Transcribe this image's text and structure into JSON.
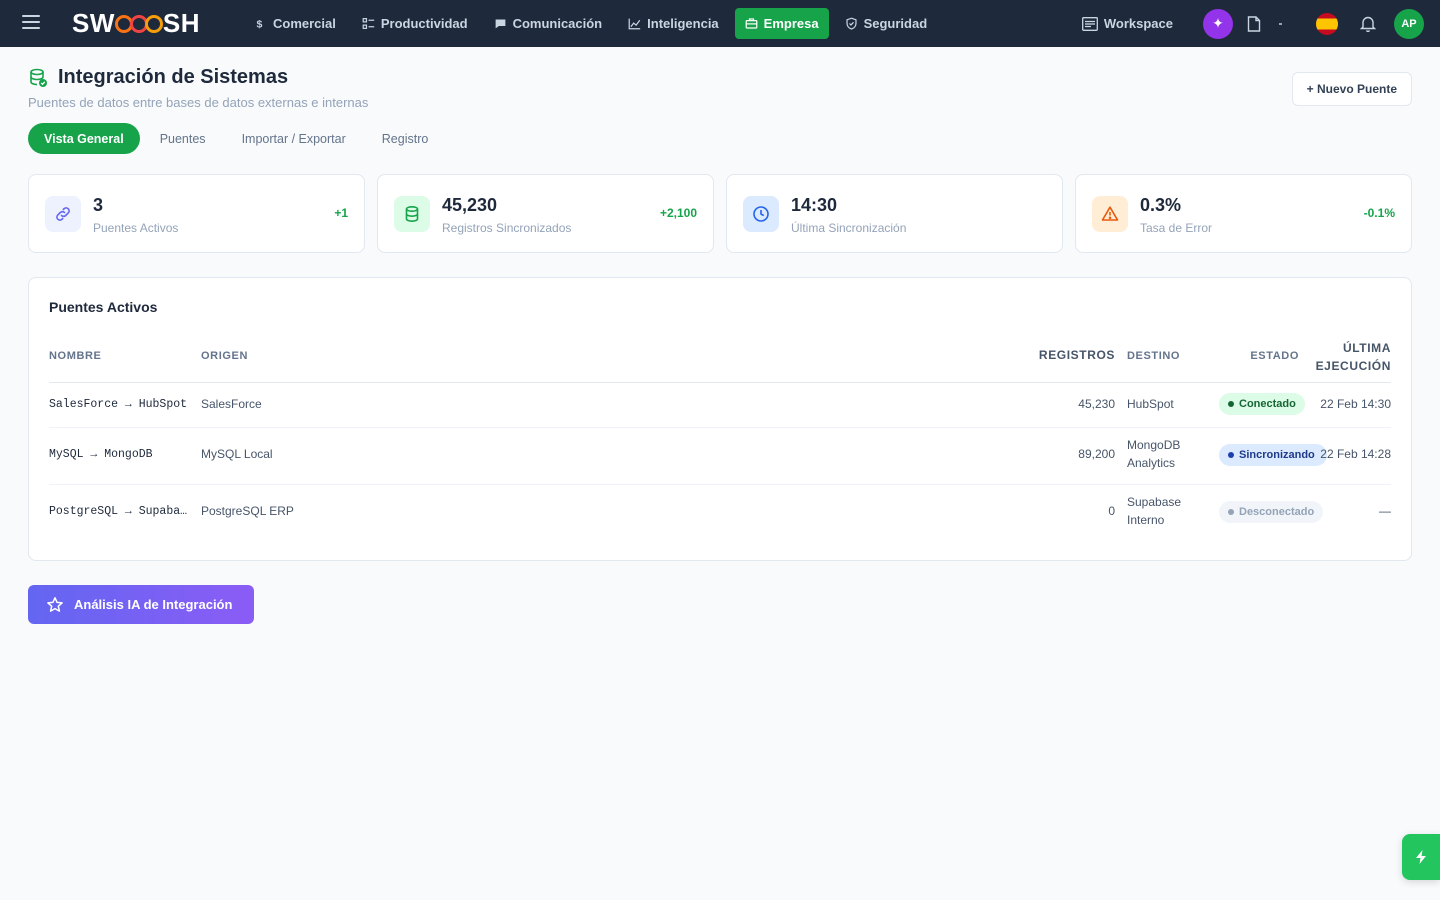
{
  "brand": {
    "logo_prefix": "SW",
    "logo_suffix": "SH"
  },
  "nav": {
    "items": [
      {
        "label": "Comercial",
        "icon": "dollar-icon"
      },
      {
        "label": "Productividad",
        "icon": "checklist-icon"
      },
      {
        "label": "Comunicación",
        "icon": "chat-icon"
      },
      {
        "label": "Inteligencia",
        "icon": "chart-line-icon"
      },
      {
        "label": "Empresa",
        "icon": "briefcase-icon",
        "active": true
      },
      {
        "label": "Seguridad",
        "icon": "shield-icon"
      }
    ],
    "workspace_label": "Workspace",
    "avatar_initials": "AP",
    "ai_glyph": "✦"
  },
  "header": {
    "title": "Integración de Sistemas",
    "subtitle": "Puentes de datos entre bases de datos externas e internas",
    "new_button": "+ Nuevo Puente"
  },
  "tabs": [
    {
      "label": "Vista General",
      "active": true
    },
    {
      "label": "Puentes"
    },
    {
      "label": "Importar / Exportar"
    },
    {
      "label": "Registro"
    }
  ],
  "stats": [
    {
      "value": "3",
      "label": "Puentes Activos",
      "delta": "+1",
      "icon": "link-icon",
      "tint": "#eef2ff",
      "color": "#6366f1"
    },
    {
      "value": "45,230",
      "label": "Registros Sincronizados",
      "delta": "+2,100",
      "icon": "database-icon",
      "tint": "#dcfce7",
      "color": "#16a34a"
    },
    {
      "value": "14:30",
      "label": "Última Sincronización",
      "delta": "",
      "icon": "clock-icon",
      "tint": "#dbeafe",
      "color": "#2563eb"
    },
    {
      "value": "0.3%",
      "label": "Tasa de Error",
      "delta": "-0.1%",
      "icon": "warning-icon",
      "tint": "#ffedd5",
      "color": "#ea580c"
    }
  ],
  "table": {
    "title": "Puentes Activos",
    "headers": {
      "name": "Nombre",
      "origin": "Origen",
      "records": "Registros",
      "destination": "Destino",
      "status": "Estado",
      "last_run_line1": "Última",
      "last_run_line2": "Ejecución"
    },
    "rows": [
      {
        "name": "SalesForce → HubSpot",
        "origin": "SalesForce",
        "records": "45,230",
        "dest_line1": "HubSpot",
        "dest_line2": "",
        "status": "Conectado",
        "status_kind": "green",
        "last_run": "22 Feb 14:30"
      },
      {
        "name": "MySQL → MongoDB",
        "origin": "MySQL Local",
        "records": "89,200",
        "dest_line1": "MongoDB",
        "dest_line2": "Analytics",
        "status": "Sincronizando",
        "status_kind": "blue",
        "last_run": "22 Feb 14:28"
      },
      {
        "name": "PostgreSQL → Supabase",
        "origin": "PostgreSQL ERP",
        "records": "0",
        "dest_line1": "Supabase",
        "dest_line2": "Interno",
        "status": "Desconectado",
        "status_kind": "gray",
        "last_run": "—"
      }
    ]
  },
  "ai_button": "Análisis IA de Integración"
}
